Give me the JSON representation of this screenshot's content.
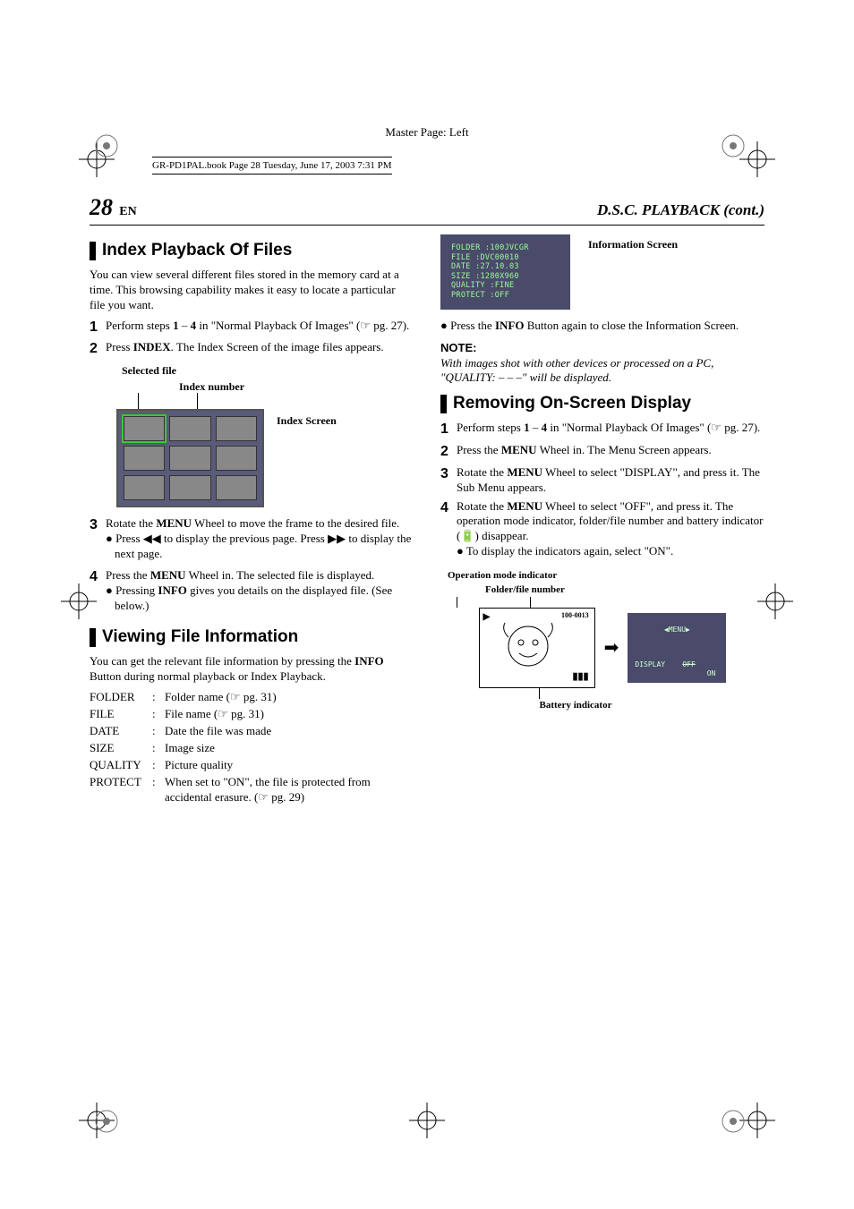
{
  "masterPage": "Master Page: Left",
  "bookInfo": "GR-PD1PAL.book  Page 28  Tuesday, June 17, 2003  7:31 PM",
  "pageNumber": "28",
  "langCode": "EN",
  "sectionTitle": "D.S.C. PLAYBACK (cont.)",
  "left": {
    "h1": "Index Playback Of Files",
    "intro": "You can view several different files stored in the memory card at a time. This browsing capability makes it easy to locate a particular file you want.",
    "step1a": "Perform steps ",
    "step1b": "1",
    "step1c": " – ",
    "step1d": "4",
    "step1e": " in \"Normal Playback Of Images\" (",
    "step1f": " pg. 27).",
    "step2a": "Press ",
    "step2b": "INDEX",
    "step2c": ". The Index Screen of the image files appears.",
    "cap_selected": "Selected file",
    "cap_indexnum": "Index number",
    "cap_indexscreen": "Index Screen",
    "step3a": "Rotate the ",
    "step3b": "MENU",
    "step3c": " Wheel to move the frame to the desired file.",
    "step3_sub1": "● Press ◀◀ to display the previous page. Press ▶▶ to display the next page.",
    "step4a": "Press the ",
    "step4b": "MENU",
    "step4c": " Wheel in. The selected file is displayed.",
    "step4_sub1a": "● Pressing ",
    "step4_sub1b": "INFO",
    "step4_sub1c": " gives you details on the displayed file. (See below.)",
    "h2": "Viewing File Information",
    "view_intro_a": "You can get the relevant file information by pressing the ",
    "view_intro_b": "INFO",
    "view_intro_c": " Button during normal playback or Index Playback.",
    "table": {
      "r1k": "FOLDER",
      "r1v": "Folder name (☞ pg. 31)",
      "r2k": "FILE",
      "r2v": "File name (☞ pg. 31)",
      "r3k": "DATE",
      "r3v": "Date the file was made",
      "r4k": "SIZE",
      "r4v": "Image size",
      "r5k": "QUALITY",
      "r5v": "Picture quality",
      "r6k": "PROTECT",
      "r6v": "When set to \"ON\", the file is protected from accidental erasure. (☞ pg. 29)"
    }
  },
  "right": {
    "cap_infoscreen": "Information Screen",
    "infoScreen": {
      "l1": "FOLDER  :100JVCGR",
      "l2": "FILE    :DVC00010",
      "l3": "DATE    :27.10.03",
      "l4": "SIZE    :1280X960",
      "l5": "QUALITY :FINE",
      "l6": "PROTECT :OFF"
    },
    "close_a": "● Press the ",
    "close_b": "INFO",
    "close_c": " Button again to close the Information Screen.",
    "note_label": "NOTE:",
    "note_text": "With images shot with other devices or processed on a PC, \"QUALITY: – – –\" will be displayed.",
    "h1": "Removing On-Screen Display",
    "s1a": "Perform steps ",
    "s1b": "1",
    "s1c": " – ",
    "s1d": "4",
    "s1e": " in \"Normal Playback Of Images\" (",
    "s1f": " pg. 27).",
    "s2a": "Press the ",
    "s2b": "MENU",
    "s2c": " Wheel in. The Menu Screen appears.",
    "s3a": "Rotate the ",
    "s3b": "MENU",
    "s3c": " Wheel to select \"DISPLAY\", and press it. The Sub Menu appears.",
    "s4a": "Rotate the ",
    "s4b": "MENU",
    "s4c": " Wheel to select \"OFF\", and press it. The operation mode indicator, folder/file number and battery indicator (🔋) disappear.",
    "s4_sub": "● To display the indicators again, select \"ON\".",
    "cap_opmode": "Operation mode indicator",
    "cap_folderfile": "Folder/file number",
    "cap_battery": "Battery indicator",
    "osd_left_folder": "100-0013",
    "osd_right_menu": "◀MENU▶",
    "osd_right_display": "DISPLAY",
    "osd_right_off": "OFF",
    "osd_right_on": "ON"
  }
}
